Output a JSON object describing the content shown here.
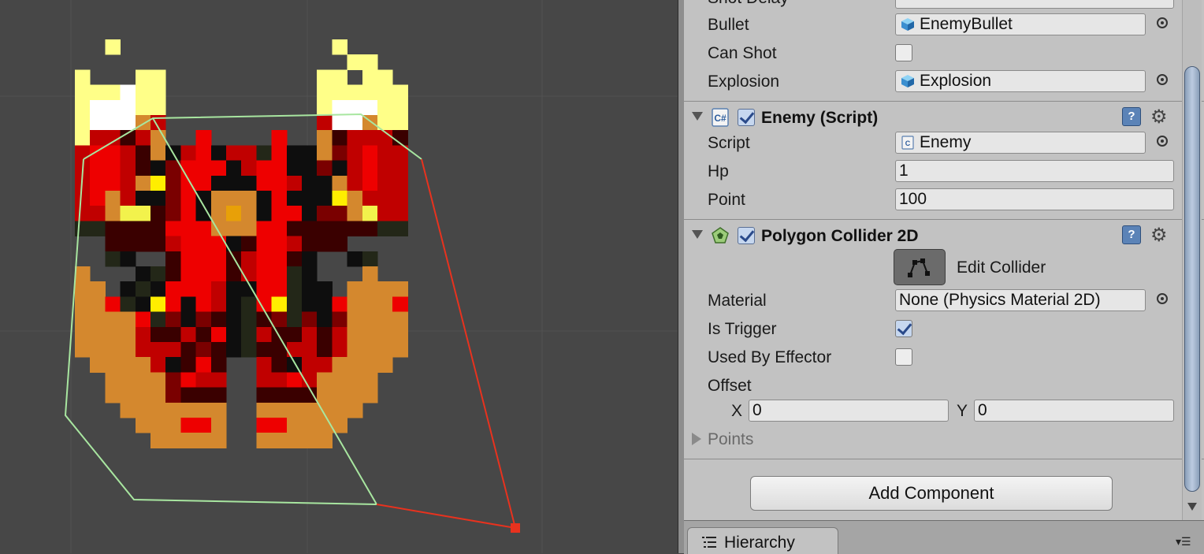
{
  "inspector": {
    "partial_top_label": "Shot Delay",
    "shooter_fields": [
      {
        "label": "Bullet",
        "value": "EnemyBullet"
      },
      {
        "label": "Can Shot",
        "checked": false
      },
      {
        "label": "Explosion",
        "value": "Explosion"
      }
    ],
    "enemy_component": {
      "title": "Enemy (Script)",
      "script_label": "Script",
      "script_value": "Enemy",
      "hp_label": "Hp",
      "hp_value": "1",
      "point_label": "Point",
      "point_value": "100"
    },
    "collider_component": {
      "title": "Polygon Collider 2D",
      "edit_collider_label": "Edit Collider",
      "material_label": "Material",
      "material_value": "None (Physics Material 2D)",
      "is_trigger_label": "Is Trigger",
      "is_trigger": true,
      "used_by_effector_label": "Used By Effector",
      "used_by_effector": false,
      "offset_label": "Offset",
      "offset_x_label": "X",
      "offset_x": "0",
      "offset_y_label": "Y",
      "offset_y": "0",
      "points_label": "Points"
    },
    "add_component_label": "Add Component"
  },
  "bottom_panel": {
    "tab_label": "Hierarchy"
  },
  "icons": {
    "prefab": "cube-icon",
    "script": "script-icon",
    "collider": "polygon-collider-icon",
    "help": "help-icon",
    "settings": "gear-icon",
    "object_picker": "object-picker-icon"
  },
  "colors": {
    "scene_background": "#474747",
    "inspector_background": "#c2c2c2",
    "collider_outline": "#a8e6a0",
    "collider_selected_edge": "#e8321e"
  }
}
